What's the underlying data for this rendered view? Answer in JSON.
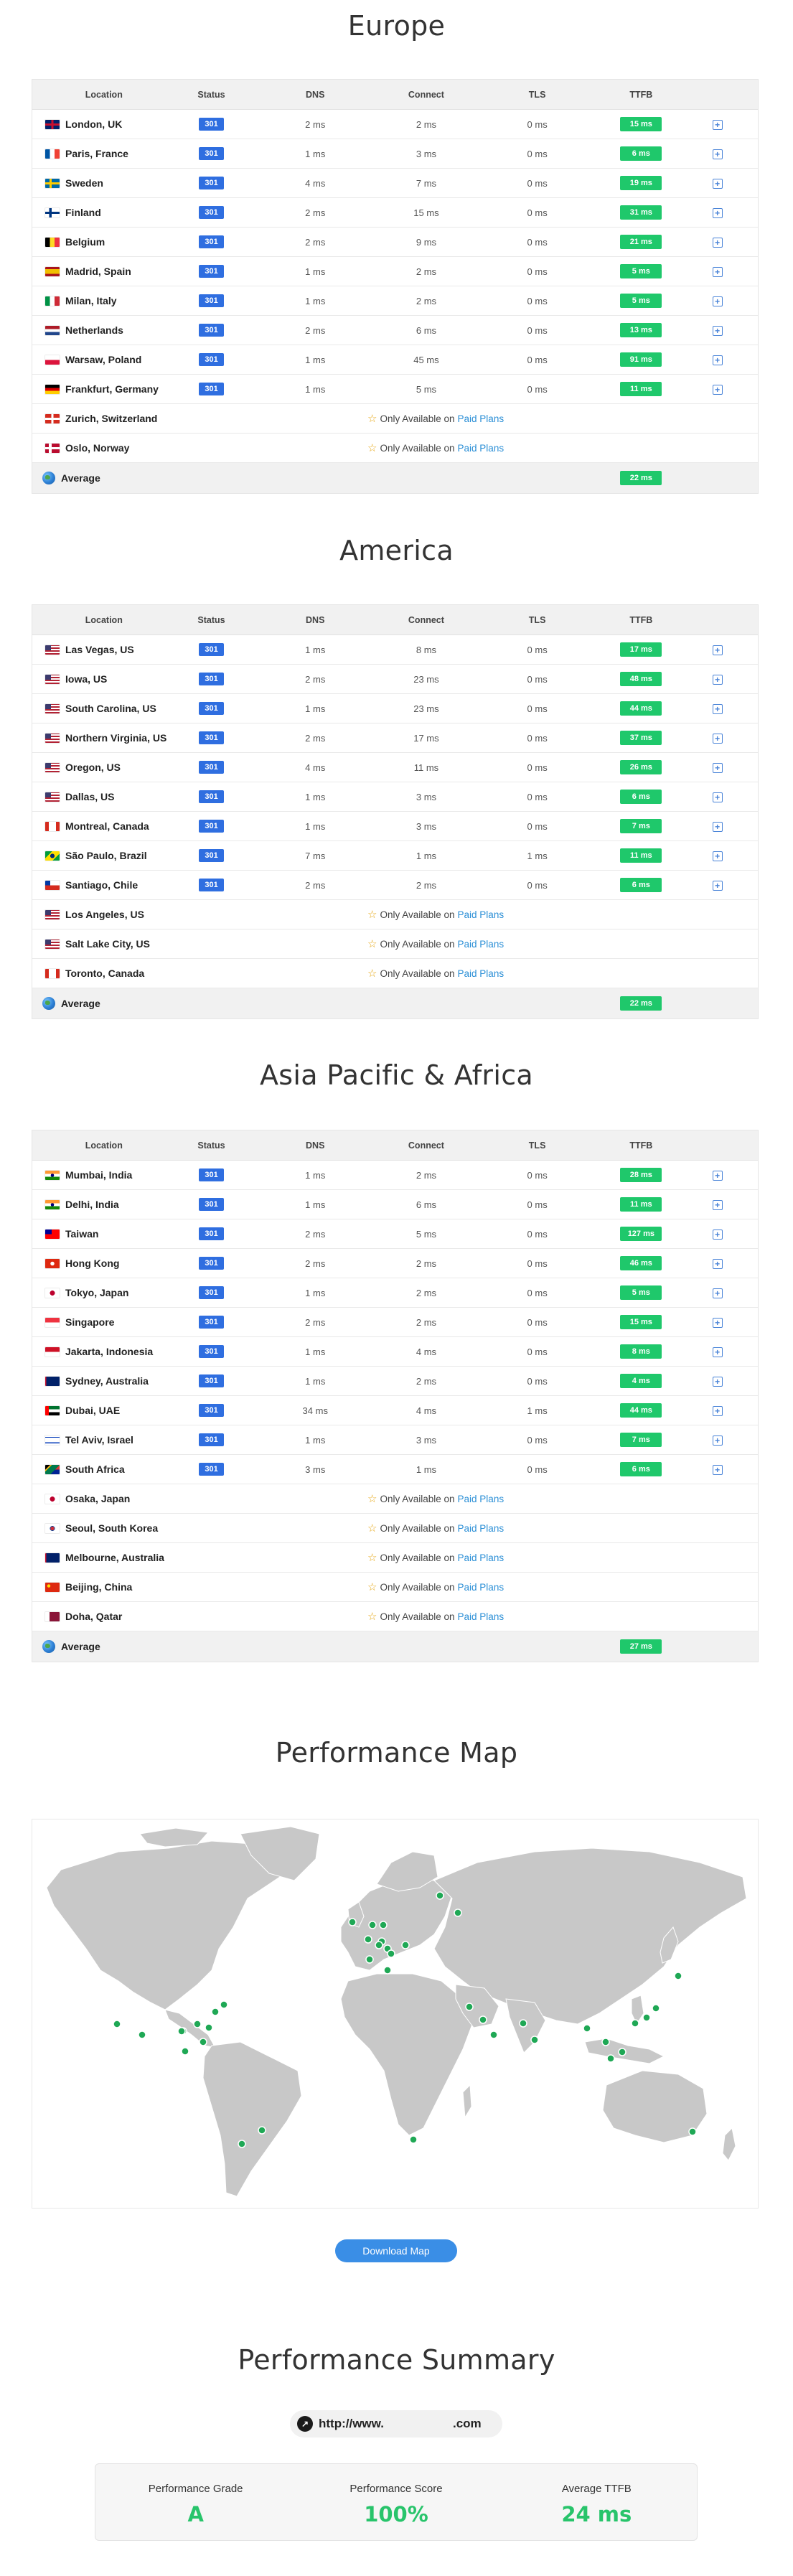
{
  "columns": {
    "location": "Location",
    "status": "Status",
    "dns": "DNS",
    "connect": "Connect",
    "tls": "TLS",
    "ttfb": "TTFB"
  },
  "paid_prefix": "Only Available on",
  "paid_link": "Paid Plans",
  "average_label": "Average",
  "regions": [
    {
      "title": "Europe",
      "rows": [
        {
          "flag": "uk",
          "name": "London, UK",
          "status": "301",
          "dns": "2 ms",
          "connect": "2 ms",
          "tls": "0 ms",
          "ttfb": "15 ms"
        },
        {
          "flag": "fr",
          "name": "Paris, France",
          "status": "301",
          "dns": "1 ms",
          "connect": "3 ms",
          "tls": "0 ms",
          "ttfb": "6 ms"
        },
        {
          "flag": "se",
          "name": "Sweden",
          "status": "301",
          "dns": "4 ms",
          "connect": "7 ms",
          "tls": "0 ms",
          "ttfb": "19 ms"
        },
        {
          "flag": "fi",
          "name": "Finland",
          "status": "301",
          "dns": "2 ms",
          "connect": "15 ms",
          "tls": "0 ms",
          "ttfb": "31 ms"
        },
        {
          "flag": "be",
          "name": "Belgium",
          "status": "301",
          "dns": "2 ms",
          "connect": "9 ms",
          "tls": "0 ms",
          "ttfb": "21 ms"
        },
        {
          "flag": "es",
          "name": "Madrid, Spain",
          "status": "301",
          "dns": "1 ms",
          "connect": "2 ms",
          "tls": "0 ms",
          "ttfb": "5 ms"
        },
        {
          "flag": "it",
          "name": "Milan, Italy",
          "status": "301",
          "dns": "1 ms",
          "connect": "2 ms",
          "tls": "0 ms",
          "ttfb": "5 ms"
        },
        {
          "flag": "nl",
          "name": "Netherlands",
          "status": "301",
          "dns": "2 ms",
          "connect": "6 ms",
          "tls": "0 ms",
          "ttfb": "13 ms"
        },
        {
          "flag": "pl",
          "name": "Warsaw, Poland",
          "status": "301",
          "dns": "1 ms",
          "connect": "45 ms",
          "tls": "0 ms",
          "ttfb": "91 ms"
        },
        {
          "flag": "de",
          "name": "Frankfurt, Germany",
          "status": "301",
          "dns": "1 ms",
          "connect": "5 ms",
          "tls": "0 ms",
          "ttfb": "11 ms"
        },
        {
          "flag": "ch",
          "name": "Zurich, Switzerland",
          "paid": true
        },
        {
          "flag": "no",
          "name": "Oslo, Norway",
          "paid": true
        }
      ],
      "average": "22 ms"
    },
    {
      "title": "America",
      "rows": [
        {
          "flag": "us",
          "name": "Las Vegas, US",
          "status": "301",
          "dns": "1 ms",
          "connect": "8 ms",
          "tls": "0 ms",
          "ttfb": "17 ms"
        },
        {
          "flag": "us",
          "name": "Iowa, US",
          "status": "301",
          "dns": "2 ms",
          "connect": "23 ms",
          "tls": "0 ms",
          "ttfb": "48 ms"
        },
        {
          "flag": "us",
          "name": "South Carolina, US",
          "status": "301",
          "dns": "1 ms",
          "connect": "23 ms",
          "tls": "0 ms",
          "ttfb": "44 ms"
        },
        {
          "flag": "us",
          "name": "Northern Virginia, US",
          "status": "301",
          "dns": "2 ms",
          "connect": "17 ms",
          "tls": "0 ms",
          "ttfb": "37 ms"
        },
        {
          "flag": "us",
          "name": "Oregon, US",
          "status": "301",
          "dns": "4 ms",
          "connect": "11 ms",
          "tls": "0 ms",
          "ttfb": "26 ms"
        },
        {
          "flag": "us",
          "name": "Dallas, US",
          "status": "301",
          "dns": "1 ms",
          "connect": "3 ms",
          "tls": "0 ms",
          "ttfb": "6 ms"
        },
        {
          "flag": "ca",
          "name": "Montreal, Canada",
          "status": "301",
          "dns": "1 ms",
          "connect": "3 ms",
          "tls": "0 ms",
          "ttfb": "7 ms"
        },
        {
          "flag": "br",
          "name": "São Paulo, Brazil",
          "status": "301",
          "dns": "7 ms",
          "connect": "1 ms",
          "tls": "1 ms",
          "ttfb": "11 ms"
        },
        {
          "flag": "cl",
          "name": "Santiago, Chile",
          "status": "301",
          "dns": "2 ms",
          "connect": "2 ms",
          "tls": "0 ms",
          "ttfb": "6 ms"
        },
        {
          "flag": "us",
          "name": "Los Angeles, US",
          "paid": true
        },
        {
          "flag": "us",
          "name": "Salt Lake City, US",
          "paid": true
        },
        {
          "flag": "ca",
          "name": "Toronto, Canada",
          "paid": true
        }
      ],
      "average": "22 ms"
    },
    {
      "title": "Asia Pacific & Africa",
      "rows": [
        {
          "flag": "in",
          "name": "Mumbai, India",
          "status": "301",
          "dns": "1 ms",
          "connect": "2 ms",
          "tls": "0 ms",
          "ttfb": "28 ms"
        },
        {
          "flag": "in",
          "name": "Delhi, India",
          "status": "301",
          "dns": "1 ms",
          "connect": "6 ms",
          "tls": "0 ms",
          "ttfb": "11 ms"
        },
        {
          "flag": "tw",
          "name": "Taiwan",
          "status": "301",
          "dns": "2 ms",
          "connect": "5 ms",
          "tls": "0 ms",
          "ttfb": "127 ms"
        },
        {
          "flag": "hk",
          "name": "Hong Kong",
          "status": "301",
          "dns": "2 ms",
          "connect": "2 ms",
          "tls": "0 ms",
          "ttfb": "46 ms"
        },
        {
          "flag": "jp",
          "name": "Tokyo, Japan",
          "status": "301",
          "dns": "1 ms",
          "connect": "2 ms",
          "tls": "0 ms",
          "ttfb": "5 ms"
        },
        {
          "flag": "sg",
          "name": "Singapore",
          "status": "301",
          "dns": "2 ms",
          "connect": "2 ms",
          "tls": "0 ms",
          "ttfb": "15 ms"
        },
        {
          "flag": "id",
          "name": "Jakarta, Indonesia",
          "status": "301",
          "dns": "1 ms",
          "connect": "4 ms",
          "tls": "0 ms",
          "ttfb": "8 ms"
        },
        {
          "flag": "au",
          "name": "Sydney, Australia",
          "status": "301",
          "dns": "1 ms",
          "connect": "2 ms",
          "tls": "0 ms",
          "ttfb": "4 ms"
        },
        {
          "flag": "ae",
          "name": "Dubai, UAE",
          "status": "301",
          "dns": "34 ms",
          "connect": "4 ms",
          "tls": "1 ms",
          "ttfb": "44 ms"
        },
        {
          "flag": "il",
          "name": "Tel Aviv, Israel",
          "status": "301",
          "dns": "1 ms",
          "connect": "3 ms",
          "tls": "0 ms",
          "ttfb": "7 ms"
        },
        {
          "flag": "za",
          "name": "South Africa",
          "status": "301",
          "dns": "3 ms",
          "connect": "1 ms",
          "tls": "0 ms",
          "ttfb": "6 ms"
        },
        {
          "flag": "jp",
          "name": "Osaka, Japan",
          "paid": true
        },
        {
          "flag": "kr",
          "name": "Seoul, South Korea",
          "paid": true
        },
        {
          "flag": "au",
          "name": "Melbourne, Australia",
          "paid": true
        },
        {
          "flag": "cn",
          "name": "Beijing, China",
          "paid": true
        },
        {
          "flag": "qa",
          "name": "Doha, Qatar",
          "paid": true
        }
      ],
      "average": "27 ms"
    }
  ],
  "map": {
    "title": "Performance Map",
    "download_label": "Download Map",
    "marker_color": "#1fa855",
    "land_color": "#c8c8c8"
  },
  "summary": {
    "title": "Performance Summary",
    "url_prefix": "http://www.",
    "url_suffix": ".com",
    "items": [
      {
        "label": "Performance Grade",
        "value": "A"
      },
      {
        "label": "Performance Score",
        "value": "100%"
      },
      {
        "label": "Average TTFB",
        "value": "24 ms"
      }
    ]
  },
  "colors": {
    "status_badge": "#2f6ee0",
    "ttfb_badge": "#1fc86b",
    "link": "#2b8fd6",
    "summary_value": "#28c46b"
  }
}
